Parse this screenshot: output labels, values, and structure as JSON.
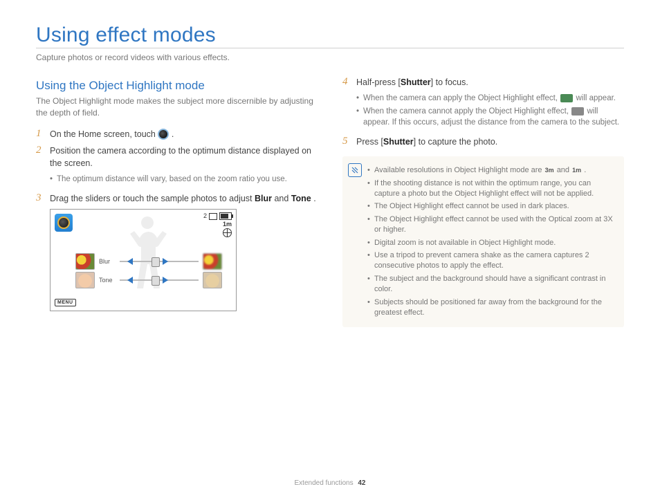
{
  "page": {
    "title": "Using effect modes",
    "intro": "Capture photos or record videos with various effects.",
    "footer_section": "Extended functions",
    "footer_page": "42"
  },
  "left": {
    "subhead": "Using the Object Highlight mode",
    "subdesc": "The Object Highlight mode makes the subject more discernible by adjusting the depth of field.",
    "step1_text_a": "On the Home screen, touch ",
    "step1_text_b": ".",
    "step2": "Position the camera according to the optimum distance displayed on the screen.",
    "step2_sub1": "The optimum distance will vary, based on the zoom ratio you use.",
    "step3_a": "Drag the sliders or touch the sample photos to adjust ",
    "step3_blur": "Blur",
    "step3_and": " and ",
    "step3_tone": "Tone",
    "step3_b": "."
  },
  "screen": {
    "shots": "2",
    "res": "1m",
    "menu": "MENU",
    "blur_label": "Blur",
    "tone_label": "Tone"
  },
  "right": {
    "step4_a": "Half-press [",
    "step4_shutter": "Shutter",
    "step4_b": "] to focus.",
    "step4_sub1_a": "When the camera can apply the Object Highlight effect, ",
    "step4_sub1_b": " will appear.",
    "step4_sub2_a": "When the camera cannot apply the Object Highlight effect, ",
    "step4_sub2_b": " will appear. If this occurs, adjust the distance from the camera to the subject.",
    "step5_a": "Press [",
    "step5_shutter": "Shutter",
    "step5_b": "] to capture the photo."
  },
  "notes": {
    "n1_a": "Available resolutions in Object Highlight mode are ",
    "n1_res1": "3m",
    "n1_and": " and ",
    "n1_res2": "1m",
    "n1_b": ".",
    "n2": "If the shooting distance is not within the optimum range, you can capture a photo but the Object Highlight effect will not be applied.",
    "n3": "The Object Highlight effect cannot be used in dark places.",
    "n4": "The Object Highlight effect cannot be used with the Optical zoom at 3X or higher.",
    "n5": "Digital zoom is not available in Object Highlight mode.",
    "n6": "Use a tripod to prevent camera shake as the camera captures 2 consecutive photos to apply the effect.",
    "n7": "The subject and the background should have a significant contrast in color.",
    "n8": "Subjects should be positioned far away from the background for the greatest effect."
  }
}
